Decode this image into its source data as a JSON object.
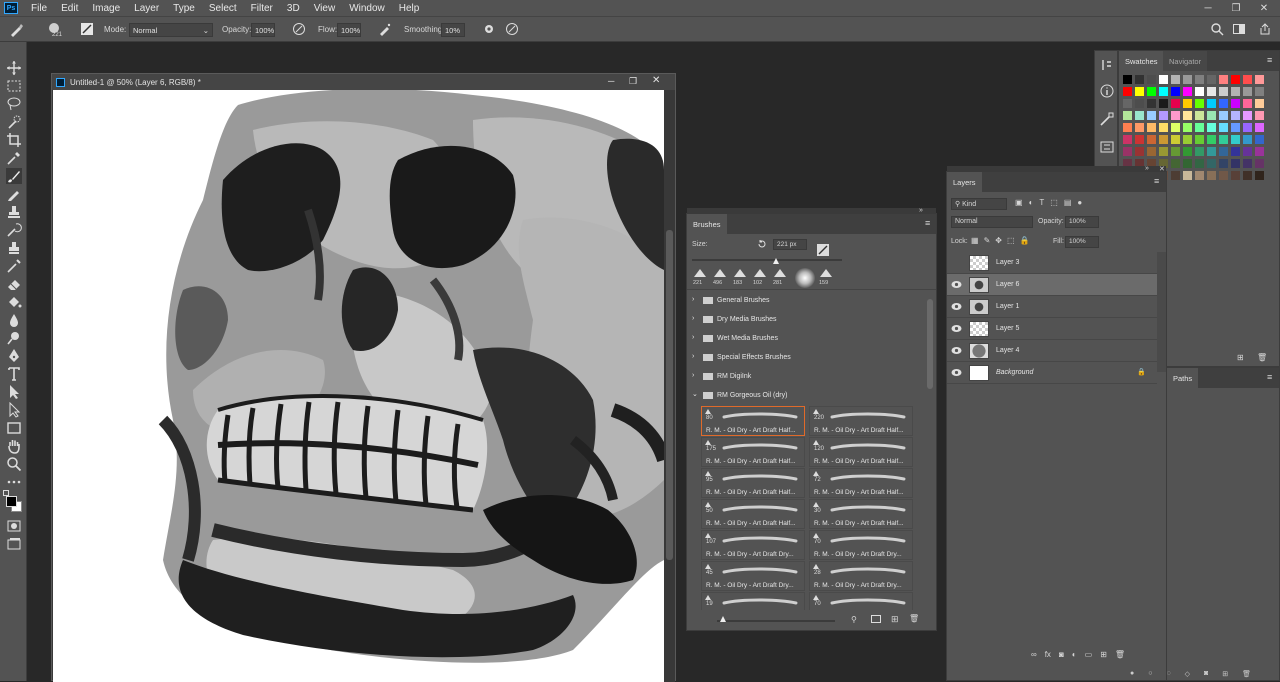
{
  "menu": {
    "app_logo": "Ps",
    "items": [
      "File",
      "Edit",
      "Image",
      "Layer",
      "Type",
      "Select",
      "Filter",
      "3D",
      "View",
      "Window",
      "Help"
    ]
  },
  "options_bar": {
    "brush_size": "221",
    "mode_label": "Mode:",
    "mode_value": "Normal",
    "opacity_label": "Opacity:",
    "opacity_value": "100%",
    "flow_label": "Flow:",
    "flow_value": "100%",
    "smoothing_label": "Smoothing:",
    "smoothing_value": "10%"
  },
  "document": {
    "title": "Untitled-1 @ 50% (Layer 6, RGB/8) *"
  },
  "brushes_panel": {
    "tab": "Brushes",
    "size_label": "Size:",
    "size_value": "221 px",
    "recent_sizes": [
      "221",
      "496",
      "183",
      "102",
      "281",
      "159"
    ],
    "folders": [
      "General Brushes",
      "Dry Media Brushes",
      "Wet Media Brushes",
      "Special Effects Brushes",
      "RM DigiInk",
      "RM Gorgeous Oil (dry)"
    ],
    "presets": [
      {
        "num": "80",
        "label": "R. M. - Oil Dry - Art Draft Half..."
      },
      {
        "num": "220",
        "label": "R. M. - Oil Dry - Art Draft Half..."
      },
      {
        "num": "175",
        "label": "R. M. - Oil Dry - Art Draft Half..."
      },
      {
        "num": "120",
        "label": "R. M. - Oil Dry - Art Draft Half..."
      },
      {
        "num": "95",
        "label": "R. M. - Oil Dry - Art Draft Half..."
      },
      {
        "num": "72",
        "label": "R. M. - Oil Dry - Art Draft Half..."
      },
      {
        "num": "50",
        "label": "R. M. - Oil Dry - Art Draft Half..."
      },
      {
        "num": "30",
        "label": "R. M. - Oil Dry - Art Draft Half..."
      },
      {
        "num": "107",
        "label": "R. M. - Oil Dry - Art Draft Dry..."
      },
      {
        "num": "70",
        "label": "R. M. - Oil Dry - Art Draft Dry..."
      },
      {
        "num": "45",
        "label": "R. M. - Oil Dry - Art Draft Dry..."
      },
      {
        "num": "28",
        "label": "R. M. - Oil Dry - Art Draft Dry..."
      },
      {
        "num": "19",
        "label": ""
      },
      {
        "num": "70",
        "label": ""
      }
    ]
  },
  "layers_panel": {
    "tab": "Layers",
    "filter_kind": "Kind",
    "blend_mode": "Normal",
    "opacity_label": "Opacity:",
    "opacity_value": "100%",
    "lock_label": "Lock:",
    "fill_label": "Fill:",
    "fill_value": "100%",
    "layers": [
      {
        "name": "Layer 3",
        "visible": false,
        "selected": false
      },
      {
        "name": "Layer 6",
        "visible": true,
        "selected": true
      },
      {
        "name": "Layer 1",
        "visible": true,
        "selected": false
      },
      {
        "name": "Layer 5",
        "visible": true,
        "selected": false
      },
      {
        "name": "Layer 4",
        "visible": true,
        "selected": false
      },
      {
        "name": "Background",
        "visible": true,
        "selected": false,
        "locked": true
      }
    ]
  },
  "swatches_panel": {
    "tabs": [
      "Swatches",
      "Navigator"
    ],
    "paths_tab": "Paths",
    "colors": [
      [
        "#000000",
        "#323232",
        "#4d4d4d",
        "#ffffff",
        "#b3b3b3",
        "#999999",
        "#808080",
        "#666666",
        "#ff8080",
        "#ff0000",
        "#ff4d4d",
        "#ff9999"
      ],
      [
        "#ff0000",
        "#ffff00",
        "#00ff00",
        "#00ffff",
        "#0000ff",
        "#ff00ff",
        "#ffffff",
        "#e6e6e6",
        "#cccccc",
        "#b3b3b3",
        "#999999",
        "#808080"
      ],
      [
        "#666666",
        "#4d4d4d",
        "#333333",
        "#1a1a1a",
        "#e6004d",
        "#ffcc00",
        "#66ff00",
        "#00ccff",
        "#3366ff",
        "#cc00ff",
        "#ff6699",
        "#ffcc99"
      ],
      [
        "#b3e699",
        "#99e6cc",
        "#99ccff",
        "#b399ff",
        "#ff99cc",
        "#ffe699",
        "#cce699",
        "#99e6b3",
        "#99ccff",
        "#b3b3ff",
        "#e699ff",
        "#ff99b3"
      ],
      [
        "#ff7f50",
        "#ff9966",
        "#ffbb66",
        "#ffdd66",
        "#ddff66",
        "#99ff66",
        "#66ff99",
        "#66ffdd",
        "#66ddff",
        "#6699ff",
        "#9966ff",
        "#dd66ff"
      ],
      [
        "#cc3366",
        "#cc3333",
        "#cc6633",
        "#cc9933",
        "#cccc33",
        "#99cc33",
        "#66cc33",
        "#33cc66",
        "#33cc99",
        "#33cccc",
        "#3399cc",
        "#3366cc"
      ],
      [
        "#993366",
        "#993333",
        "#996633",
        "#999933",
        "#669933",
        "#339933",
        "#339966",
        "#339999",
        "#336699",
        "#333399",
        "#663399",
        "#993399"
      ],
      [
        "#663344",
        "#663333",
        "#664433",
        "#666633",
        "#446633",
        "#336633",
        "#336644",
        "#336666",
        "#334466",
        "#333366",
        "#443366",
        "#663366"
      ],
      [
        "#b3a080",
        "#998066",
        "#806650",
        "#664d40",
        "#4d3d33",
        "#c8b89a",
        "#a08870",
        "#887058",
        "#705848",
        "#584038",
        "#403028",
        "#30241c"
      ]
    ]
  }
}
